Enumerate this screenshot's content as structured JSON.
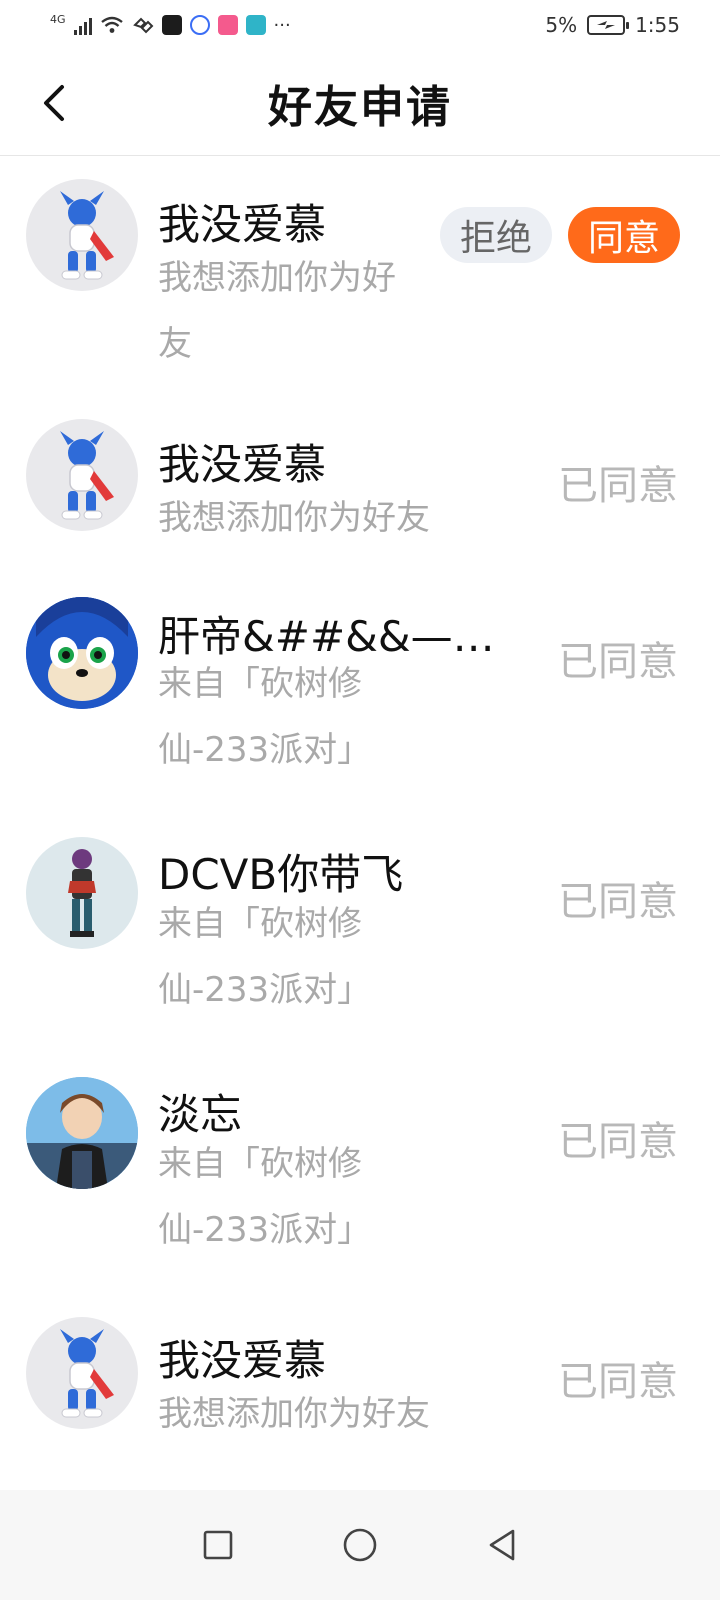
{
  "status_bar": {
    "network": "4G",
    "battery": "5%",
    "time": "1:55",
    "more": "···",
    "icons": [
      "signal-icon",
      "wifi-icon",
      "nfc-icon",
      "app-icon",
      "baidu-icon",
      "app-icon",
      "app-icon"
    ]
  },
  "header": {
    "title": "好友申请",
    "back_icon": "chevron-left-icon"
  },
  "requests": [
    {
      "name": "我没爱慕",
      "message": "我想添加你为好友",
      "actions": {
        "reject": "拒绝",
        "accept": "同意"
      }
    },
    {
      "name": "我没爱慕",
      "message": "我想添加你为好友",
      "status": "已同意"
    },
    {
      "name": "肝帝&##&&——...",
      "message": "来自「砍树修仙-233派对」",
      "status": "已同意"
    },
    {
      "name": "DCVB你带飞",
      "message": "来自「砍树修仙-233派对」",
      "status": "已同意"
    },
    {
      "name": "淡忘",
      "message": "来自「砍树修仙-233派对」",
      "status": "已同意"
    },
    {
      "name": "我没爱慕",
      "message": "我想添加你为好友",
      "status": "已同意"
    }
  ],
  "nav": {
    "recents": "square-icon",
    "home": "circle-icon",
    "back": "triangle-back-icon"
  },
  "colors": {
    "accent": "#ff6a1a",
    "reject_bg": "#eceff4",
    "muted_text": "#a9a9a9"
  }
}
